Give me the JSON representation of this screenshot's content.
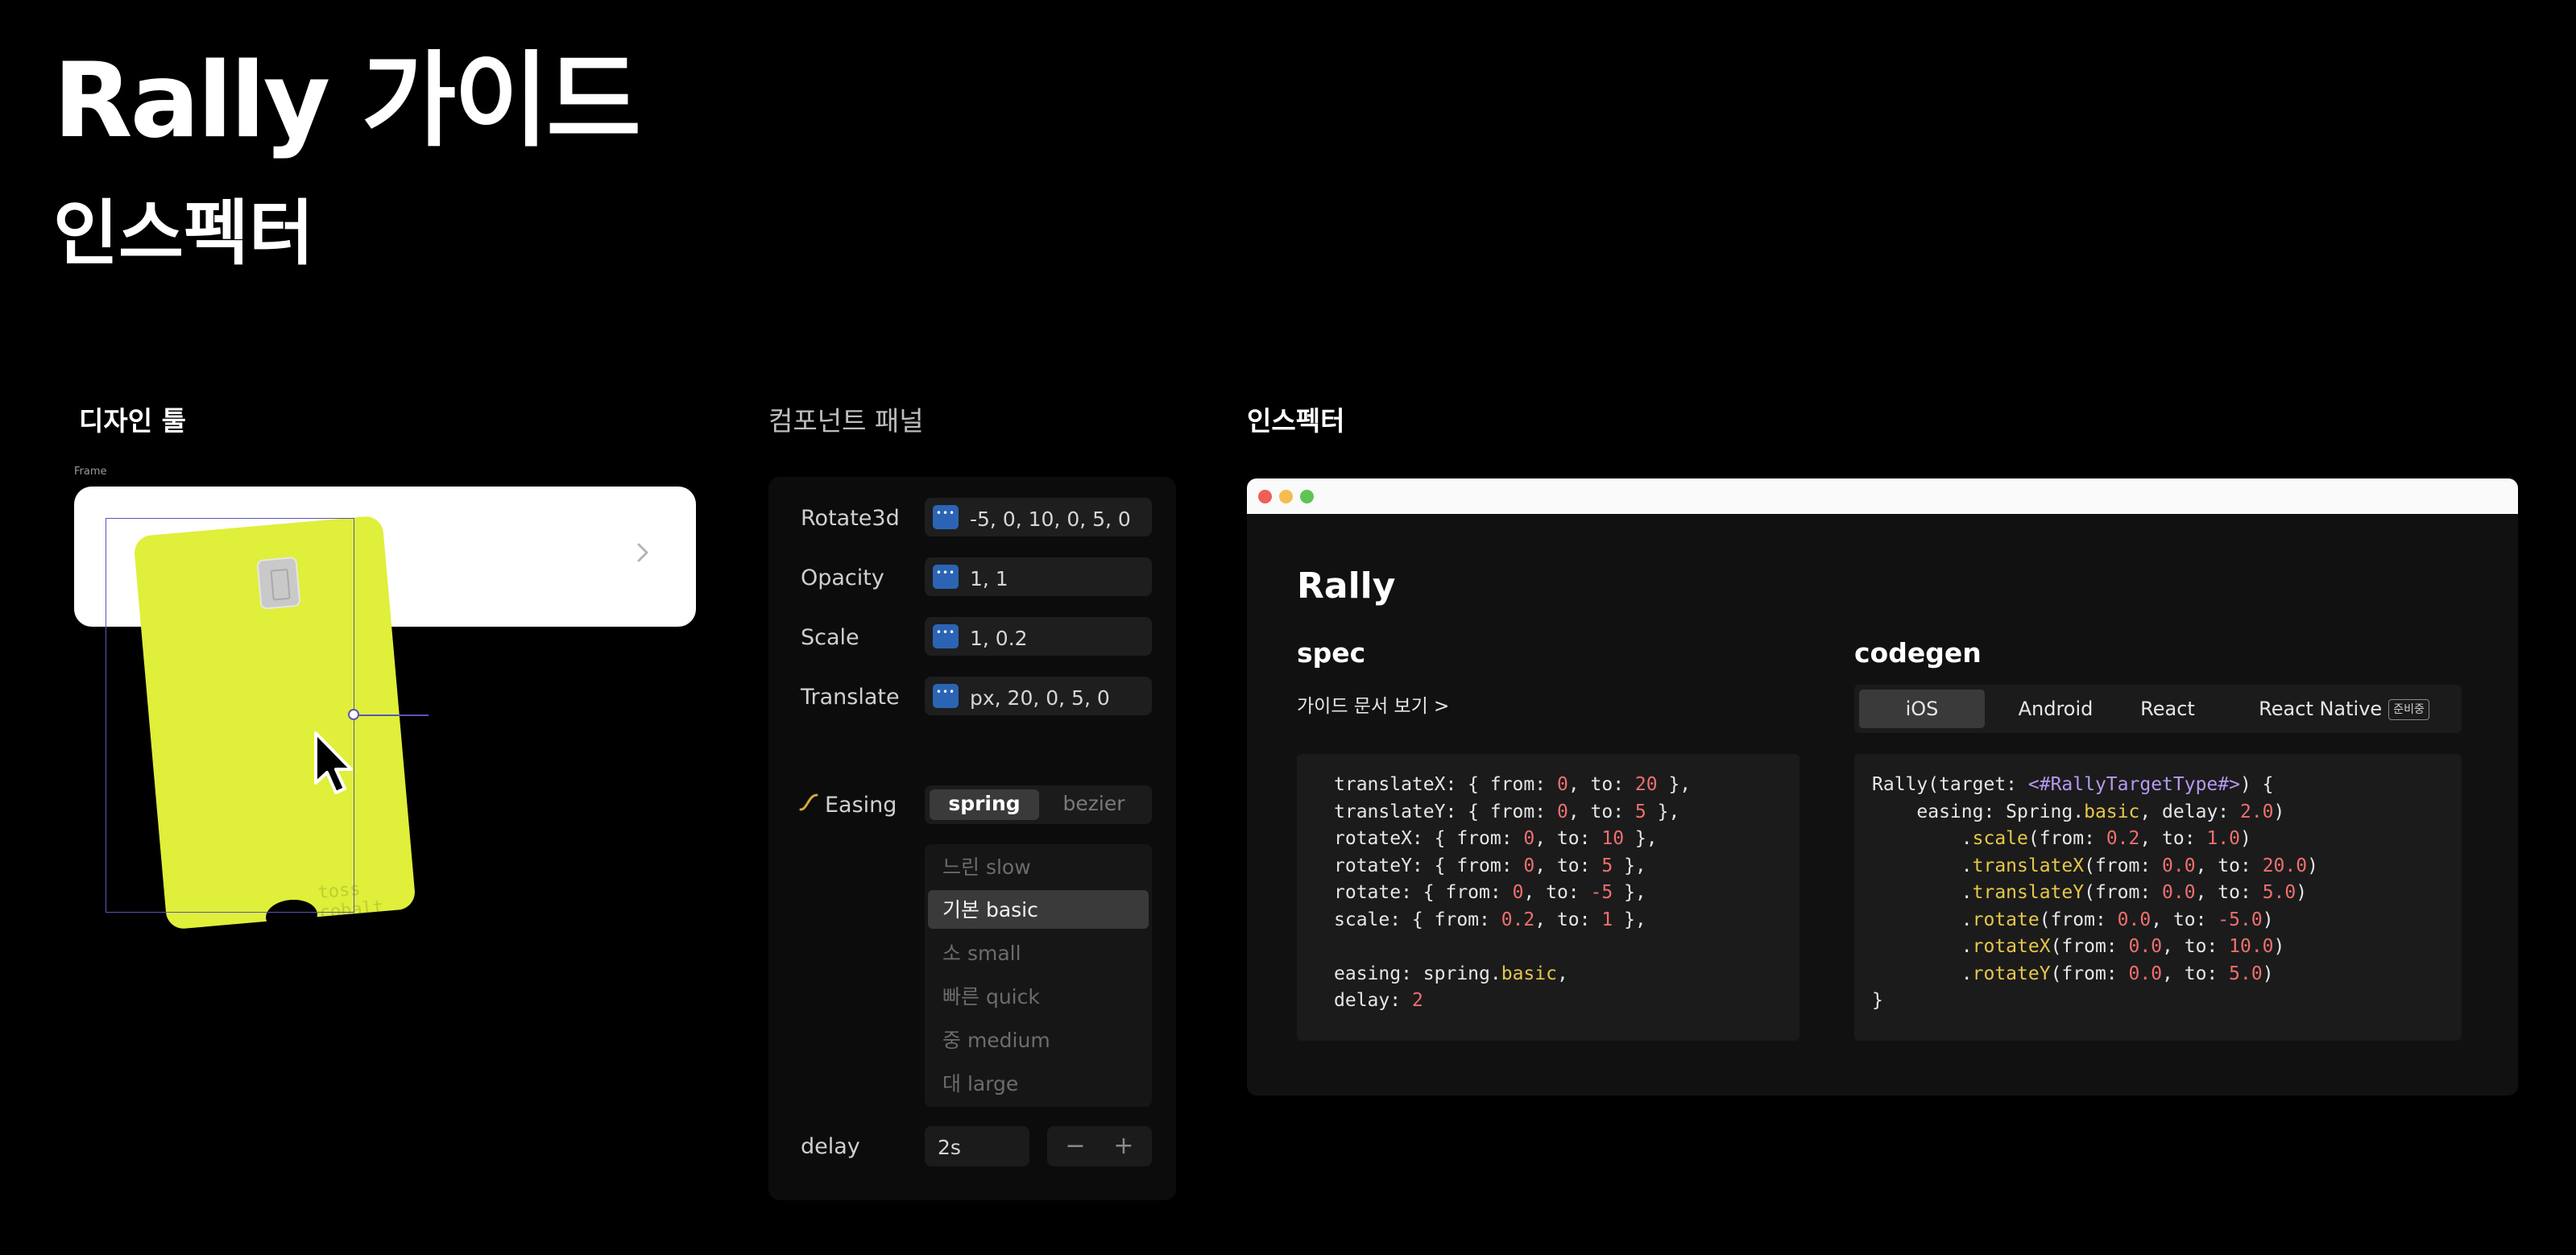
{
  "header": {
    "title": "Rally 가이드",
    "subtitle": "인스펙터"
  },
  "design_tool": {
    "label": "디자인 툴",
    "frame_label": "Frame",
    "card_label": "toss cobalt",
    "card_color": "#dfef3a"
  },
  "component_panel": {
    "label": "컴포넌트 패널",
    "props": [
      {
        "label": "Rotate3d",
        "value": "-5, 0, 10, 0, 5, 0"
      },
      {
        "label": "Opacity",
        "value": "1, 1"
      },
      {
        "label": "Scale",
        "value": "1, 0.2"
      },
      {
        "label": "Translate",
        "value": "px, 20, 0, 5, 0"
      }
    ],
    "easing_label": "Easing",
    "easing_options": [
      "spring",
      "bezier"
    ],
    "easing_selected": "spring",
    "presets": [
      "느린 slow",
      "기본 basic",
      "소 small",
      "빠른 quick",
      "중 medium",
      "대 large"
    ],
    "preset_selected": "기본 basic",
    "delay_label": "delay",
    "delay_value": "2s",
    "stepper": {
      "minus": "−",
      "plus": "+"
    }
  },
  "inspector": {
    "label": "인스펙터",
    "window_dots": [
      "#ee5f57",
      "#f5bd4f",
      "#5fc454"
    ],
    "title": "Rally",
    "spec": {
      "heading": "spec",
      "link": "가이드 문서 보기 >",
      "code": [
        "translateX: { from: 0, to: 20 },",
        "translateY: { from: 0, to: 5 },",
        "rotateX: { from: 0, to: 10 },",
        "rotateY: { from: 0, to: 5 },",
        "rotate: { from: 0, to: -5 },",
        "scale: { from: 0.2, to: 1 },",
        "",
        "easing: spring.basic,",
        "delay: 2"
      ]
    },
    "codegen": {
      "heading": "codegen",
      "tabs": [
        "iOS",
        "Android",
        "React",
        "React Native"
      ],
      "selected_tab": "iOS",
      "badge": "준비중",
      "code": [
        "Rally(target: <#RallyTargetType#>) {",
        "    easing: Spring.basic, delay: 2.0)",
        "        .scale(from: 0.2, to: 1.0)",
        "        .translateX(from: 0.0, to: 20.0)",
        "        .translateY(from: 0.0, to: 5.0)",
        "        .rotate(from: 0.0, to: -5.0)",
        "        .rotateX(from: 0.0, to: 10.0)",
        "        .rotateY(from: 0.0, to: 5.0)",
        "}"
      ]
    }
  }
}
